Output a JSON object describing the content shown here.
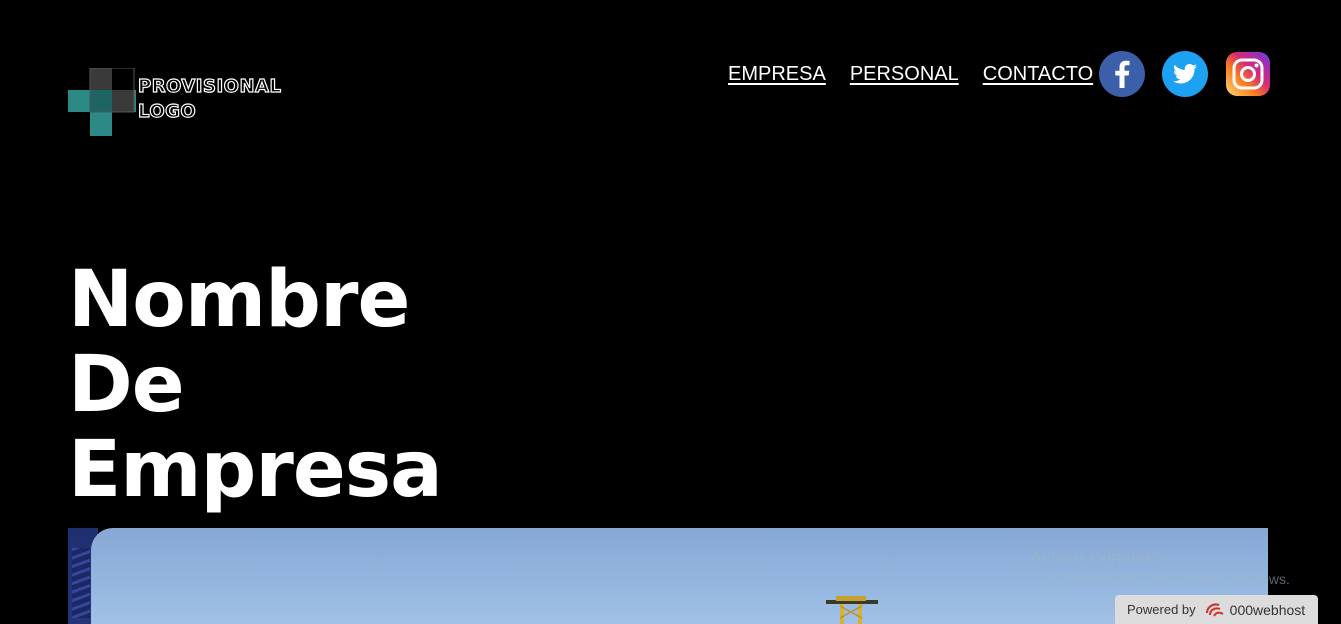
{
  "header": {
    "logo": {
      "line1": "PROVISIONAL",
      "line2": "LOGO",
      "colors": {
        "teal": "#2b8a86",
        "dark": "#3a3a3a"
      }
    },
    "nav": [
      {
        "label": "EMPRESA"
      },
      {
        "label": "PERSONAL"
      },
      {
        "label": "CONTACTO"
      }
    ],
    "social": [
      {
        "icon": "facebook-icon",
        "color": "#3b5998"
      },
      {
        "icon": "twitter-icon",
        "color": "#1da1f2"
      },
      {
        "icon": "instagram-icon",
        "color": "#e1306c"
      }
    ]
  },
  "hero": {
    "title_lines": [
      "Nombre",
      "De",
      "Empresa"
    ]
  },
  "overlay": {
    "windows_title": "Activar Windows",
    "windows_sub": "Ve a Configuración para activar Windows.",
    "powered_label": "Powered by",
    "powered_brand": "000webhost"
  }
}
